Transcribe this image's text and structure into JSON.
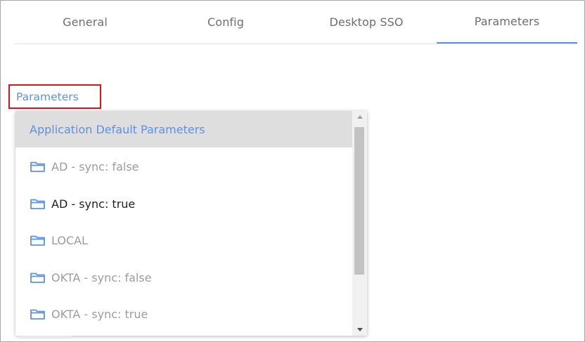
{
  "tabs": [
    {
      "label": "General"
    },
    {
      "label": "Config"
    },
    {
      "label": "Desktop SSO"
    },
    {
      "label": "Parameters"
    }
  ],
  "active_tab": "Parameters",
  "field": {
    "label": "Parameters"
  },
  "dropdown": {
    "header": "Application Default Parameters",
    "items": [
      {
        "label": "AD - sync: false",
        "icon": "folder-icon",
        "state": "muted"
      },
      {
        "label": "AD - sync: true",
        "icon": "folder-icon",
        "state": "normal"
      },
      {
        "label": "LOCAL",
        "icon": "folder-icon",
        "state": "muted"
      },
      {
        "label": "OKTA - sync: false",
        "icon": "folder-icon",
        "state": "muted"
      },
      {
        "label": "OKTA - sync: true",
        "icon": "folder-icon",
        "state": "muted"
      }
    ]
  },
  "colors": {
    "accent": "#5b92e5",
    "highlight_border": "#e0131b",
    "header_bg": "#dedede",
    "muted_text": "#9c9c9c",
    "normal_text": "#1f1f1f"
  }
}
